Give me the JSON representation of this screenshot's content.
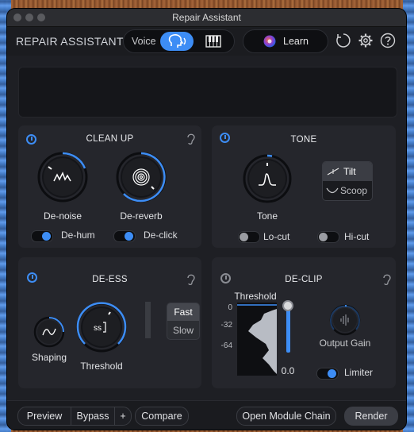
{
  "window": {
    "title": "Repair Assistant"
  },
  "header": {
    "brand": "REPAIR ASSISTANT",
    "mode_label": "Voice",
    "mode_selected": "voice",
    "learn_label": "Learn"
  },
  "clean_up": {
    "title": "CLEAN UP",
    "denoise_label": "De-noise",
    "dereverb_label": "De-reverb",
    "dehum_label": "De-hum",
    "dehum_on": true,
    "declick_label": "De-click",
    "declick_on": true
  },
  "tone": {
    "title": "TONE",
    "knob_label": "Tone",
    "tilt_label": "Tilt",
    "scoop_label": "Scoop",
    "selected": "Tilt",
    "locut_label": "Lo-cut",
    "locut_on": false,
    "hicut_label": "Hi-cut",
    "hicut_on": false
  },
  "de_ess": {
    "title": "DE-ESS",
    "shaping_label": "Shaping",
    "threshold_label": "Threshold",
    "fast_label": "Fast",
    "slow_label": "Slow",
    "selected": "Fast"
  },
  "de_clip": {
    "title": "DE-CLIP",
    "threshold_label": "Threshold",
    "ticks": [
      "0",
      "-32",
      "-64"
    ],
    "threshold_value": "0.0",
    "output_gain_label": "Output Gain",
    "limiter_label": "Limiter",
    "limiter_on": true
  },
  "footer": {
    "preview_label": "Preview",
    "bypass_label": "Bypass",
    "add_label": "+",
    "compare_label": "Compare",
    "open_chain_label": "Open Module Chain",
    "render_label": "Render"
  },
  "colors": {
    "accent": "#3d8df5",
    "panel": "#25262c",
    "background": "#1e1f24"
  }
}
